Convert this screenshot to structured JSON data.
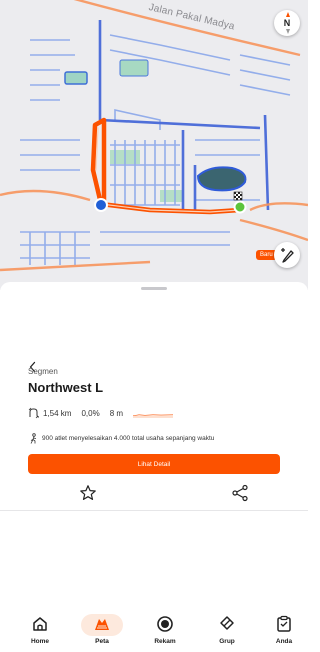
{
  "map": {
    "street_name": "Jalan Pakal Madya",
    "compass_label": "N",
    "new_badge": "Baru",
    "accent_color": "#fc5200",
    "start_marker_color": "#1f5fd6",
    "end_marker_color": "#5cc43c"
  },
  "segment": {
    "type_label": "Segmen",
    "name": "Northwest L",
    "distance": "1,54 km",
    "grade": "0,0%",
    "elevation": "8 m",
    "athletes_text": "900 atlet menyelesaikan 4.000 total usaha sepanjang waktu",
    "detail_button": "Lihat Detail"
  },
  "nav": {
    "items": [
      {
        "label": "Home",
        "icon": "home-icon"
      },
      {
        "label": "Peta",
        "icon": "map-icon",
        "active": true
      },
      {
        "label": "Rekam",
        "icon": "record-icon"
      },
      {
        "label": "Grup",
        "icon": "group-icon"
      },
      {
        "label": "Anda",
        "icon": "profile-icon"
      }
    ]
  }
}
